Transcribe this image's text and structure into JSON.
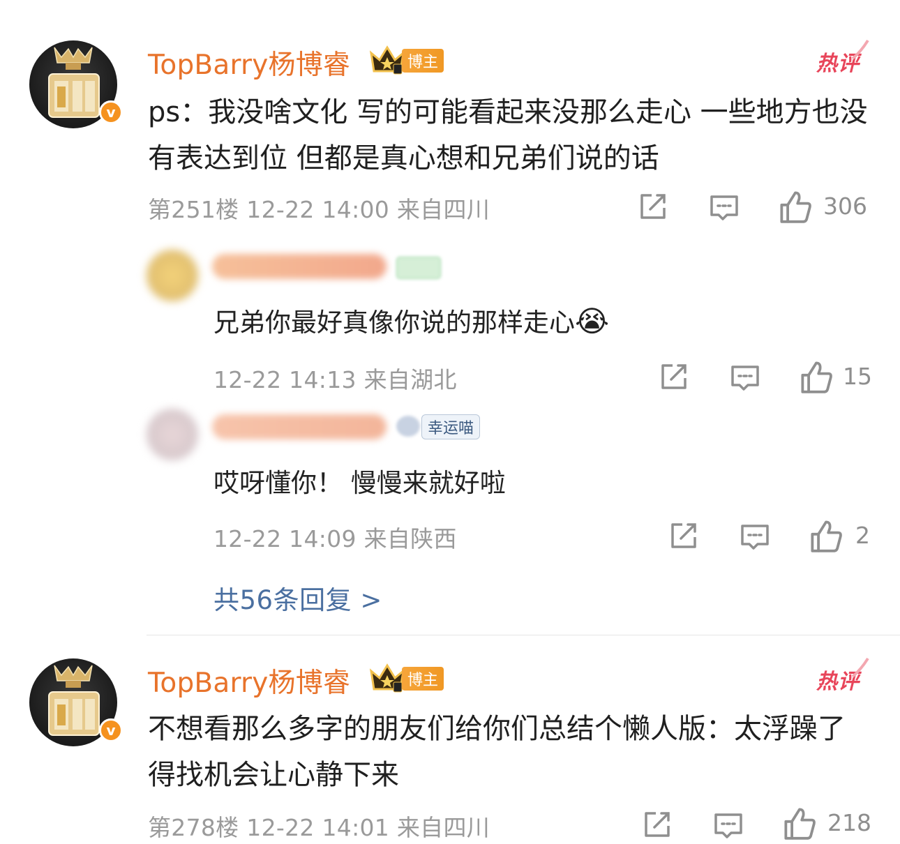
{
  "comments": [
    {
      "username": "TopBarry杨博睿",
      "tag": "博主",
      "hot": "热评",
      "text": "ps：我没啥文化 写的可能看起来没那么走心 一些地方也没有表达到位 但都是真心想和兄弟们说的话",
      "floor": "第251楼",
      "time": "12-22 14:00",
      "location": "来自四川",
      "likes": "306",
      "verified_symbol": "v"
    },
    {
      "username": "TopBarry杨博睿",
      "tag": "博主",
      "hot": "热评",
      "text": "不想看那么多字的朋友们给你们总结个懒人版：太浮躁了 得找机会让心静下来",
      "floor": "第278楼",
      "time": "12-22 14:01",
      "location": "来自四川",
      "likes": "218",
      "verified_symbol": "v"
    }
  ],
  "replies": [
    {
      "text": "兄弟你最好真像你说的那样走心",
      "emoji": "😭",
      "time": "12-22 14:13",
      "location": "来自湖北",
      "likes": "15"
    },
    {
      "tag": "幸运喵",
      "text": "哎呀懂你！ 慢慢来就好啦",
      "time": "12-22 14:09",
      "location": "来自陕西",
      "likes": "2"
    }
  ],
  "more_replies": "共56条回复 >",
  "colors": {
    "username": "#e8732b",
    "hot": "#e8455a",
    "link": "#4a6fa0",
    "meta": "#9a9a9a"
  }
}
